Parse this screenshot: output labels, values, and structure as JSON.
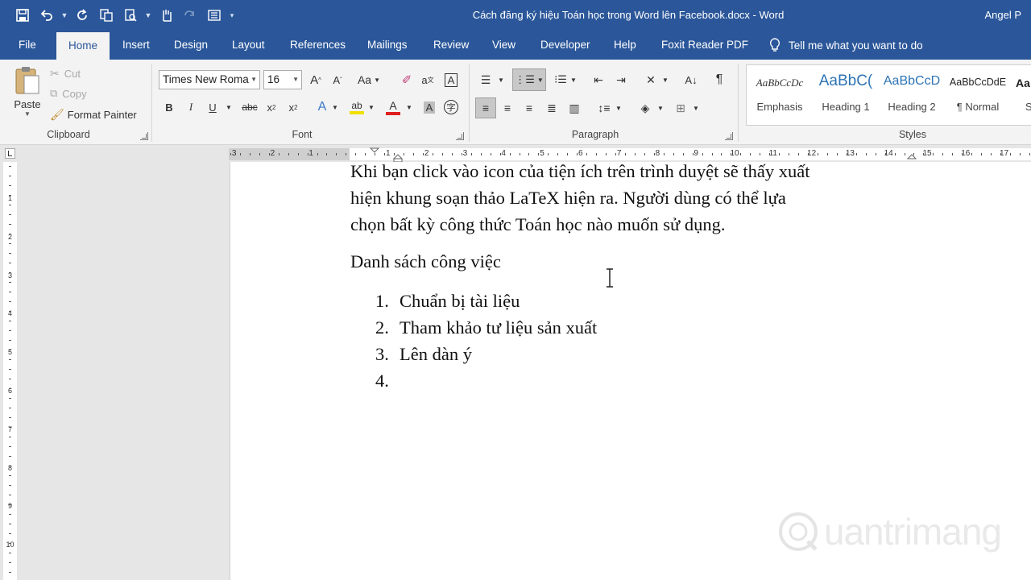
{
  "window": {
    "title": "Cách đăng ký hiệu Toán học trong Word lên Facebook.docx  -  Word",
    "user": "Angel P"
  },
  "tabs": [
    {
      "label": "File"
    },
    {
      "label": "Home"
    },
    {
      "label": "Insert"
    },
    {
      "label": "Design"
    },
    {
      "label": "Layout"
    },
    {
      "label": "References"
    },
    {
      "label": "Mailings"
    },
    {
      "label": "Review"
    },
    {
      "label": "View"
    },
    {
      "label": "Developer"
    },
    {
      "label": "Help"
    },
    {
      "label": "Foxit Reader PDF"
    }
  ],
  "tell_me": "Tell me what you want to do",
  "clipboard": {
    "paste": "Paste",
    "cut": "Cut",
    "copy": "Copy",
    "format_painter": "Format Painter",
    "label": "Clipboard"
  },
  "font": {
    "name": "Times New Roma",
    "size": "16",
    "label": "Font"
  },
  "paragraph": {
    "label": "Paragraph"
  },
  "styles": {
    "label": "Styles",
    "items": [
      {
        "preview": "AaBbCcDc",
        "name": "Emphasis"
      },
      {
        "preview": "AaBbC(",
        "name": "Heading 1"
      },
      {
        "preview": "AaBbCcD",
        "name": "Heading 2"
      },
      {
        "preview": "AaBbCcDdE",
        "name": "¶ Normal"
      },
      {
        "preview": "Aa",
        "name": "S"
      }
    ]
  },
  "ruler": {
    "numbers": [
      "3",
      "2",
      "1",
      "1",
      "2",
      "3",
      "4",
      "5",
      "6",
      "7",
      "8",
      "9",
      "10",
      "11",
      "12",
      "13",
      "14",
      "15",
      "16",
      "17"
    ]
  },
  "vruler": {
    "numbers": [
      "1",
      "2",
      "3",
      "4",
      "5",
      "6",
      "7",
      "8",
      "9",
      "10"
    ]
  },
  "document": {
    "paragraph_lines": [
      "Khi bạn click vào icon của tiện ích trên trình duyệt sẽ thấy xuất",
      "hiện khung soạn thảo LaTeX hiện ra. Người dùng có thể lựa",
      "chọn bất kỳ công thức Toán học nào muốn sử dụng."
    ],
    "list_heading": "Danh sách công việc",
    "list": [
      {
        "num": "1.",
        "text": "Chuẩn bị tài liệu"
      },
      {
        "num": "2.",
        "text": "Tham khảo tư liệu sản xuất"
      },
      {
        "num": "3.",
        "text": "Lên dàn ý"
      },
      {
        "num": "4.",
        "text": ""
      }
    ]
  },
  "watermark": "uantrimang"
}
